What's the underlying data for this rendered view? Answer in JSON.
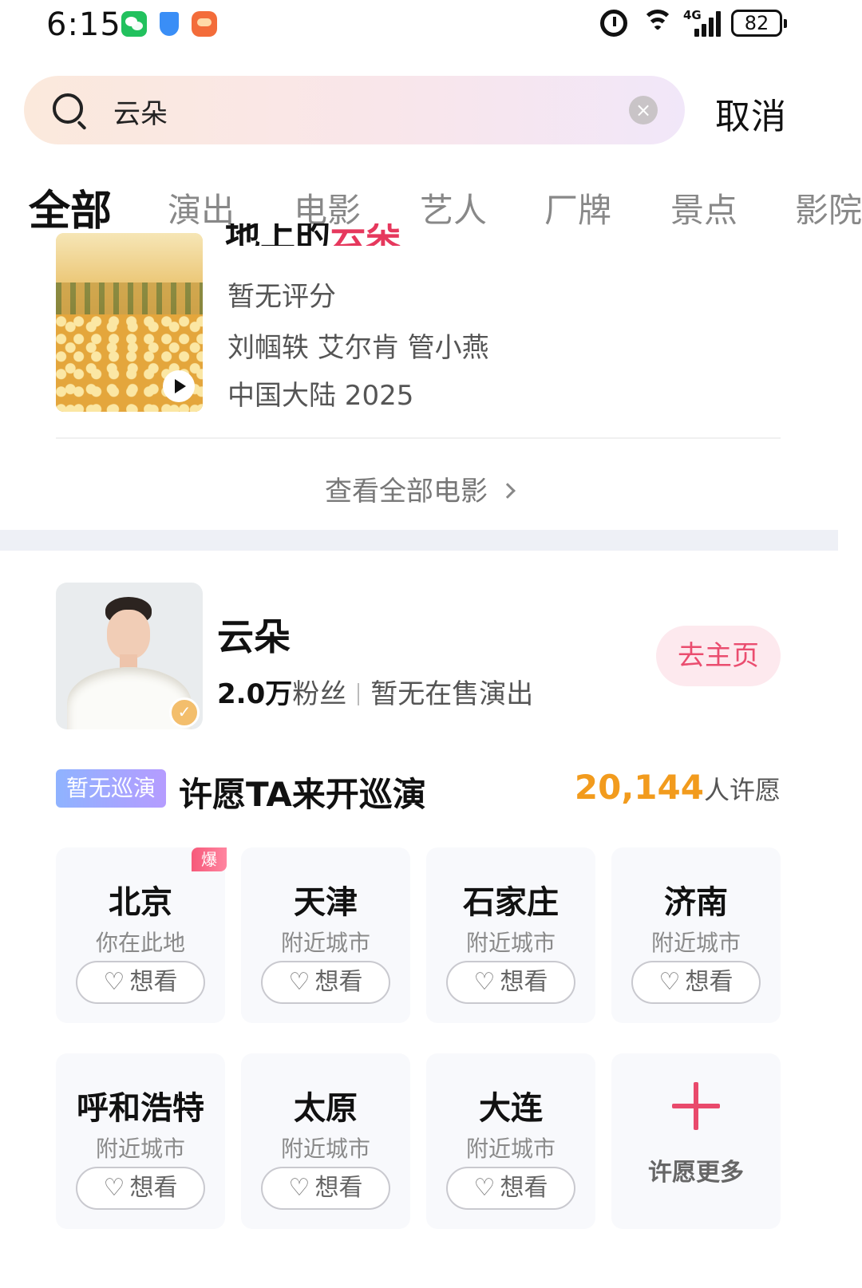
{
  "status_bar": {
    "time": "6:15",
    "network": "4G",
    "battery": "82"
  },
  "search": {
    "query": "云朵",
    "cancel_label": "取消"
  },
  "tabs": [
    {
      "label": "全部",
      "active": true
    },
    {
      "label": "演出"
    },
    {
      "label": "电影"
    },
    {
      "label": "艺人"
    },
    {
      "label": "厂牌"
    },
    {
      "label": "景点"
    },
    {
      "label": "影院"
    }
  ],
  "movie": {
    "title_prefix": "地上的",
    "title_highlight": "云朵",
    "rating": "暂无评分",
    "cast": "刘帼轶 艾尔肯 管小燕",
    "region_year": "中国大陆 2025"
  },
  "view_all_label": "查看全部电影",
  "artist": {
    "name": "云朵",
    "fans_number": "2.0万",
    "fans_label": "粉丝",
    "status": "暂无在售演出",
    "home_button": "去主页"
  },
  "wish": {
    "tag": "暂无巡演",
    "title": "许愿TA来开巡演",
    "count": "20,144",
    "count_suffix": "人许愿",
    "hot_badge": "爆",
    "want_label": "想看",
    "more_label": "许愿更多",
    "cities": [
      {
        "name": "北京",
        "sub": "你在此地"
      },
      {
        "name": "天津",
        "sub": "附近城市"
      },
      {
        "name": "石家庄",
        "sub": "附近城市"
      },
      {
        "name": "济南",
        "sub": "附近城市"
      },
      {
        "name": "呼和浩特",
        "sub": "附近城市"
      },
      {
        "name": "太原",
        "sub": "附近城市"
      },
      {
        "name": "大连",
        "sub": "附近城市"
      }
    ]
  },
  "colors": {
    "accent": "#e94a6c",
    "wish_count": "#f29b1d",
    "tour_tag": "#9fa7ff"
  }
}
